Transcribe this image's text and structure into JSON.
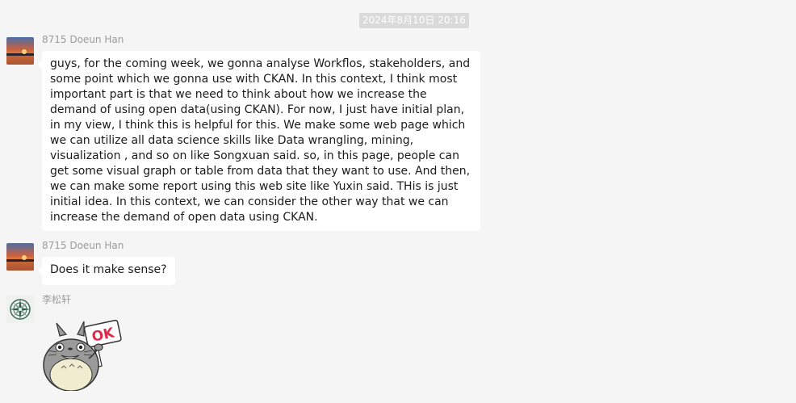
{
  "chat": {
    "timestamp": "2024年8月10日 20:16",
    "messages": [
      {
        "sender": "8715 Doeun Han",
        "avatar_icon": "sunset-photo-avatar",
        "text": "guys, for the coming week, we gonna analyse Workflos, stakeholders, and some point which we gonna use with CKAN. In this context, I think most important part is that we need to think about how we increase the demand of using open data(using CKAN). For now, I just have initial plan, in my view, I think this is helpful for this. We make some web page which we can utilize all data science skills like Data wrangling, mining, visualization , and so on like Songxuan said. so, in this page, people can get some visual graph or table from data that they want to use. And then, we can make some report using this web site like Yuxin said. THis is just initial idea. In this context, we can consider the other way that we can increase the demand of open data using CKAN."
      },
      {
        "sender": "8715 Doeun Han",
        "avatar_icon": "sunset-photo-avatar",
        "text": "Does it make sense?"
      },
      {
        "sender": "李松轩",
        "avatar_icon": "compass-avatar",
        "sticker_icon": "totoro-ok-sticker",
        "sticker_text": "OK"
      }
    ]
  },
  "colors": {
    "background": "#f5f5f5",
    "bubble": "#ffffff",
    "sender_text": "#9b9b9b",
    "timestamp_bg": "#dadada",
    "ok_red": "#e2294a"
  }
}
